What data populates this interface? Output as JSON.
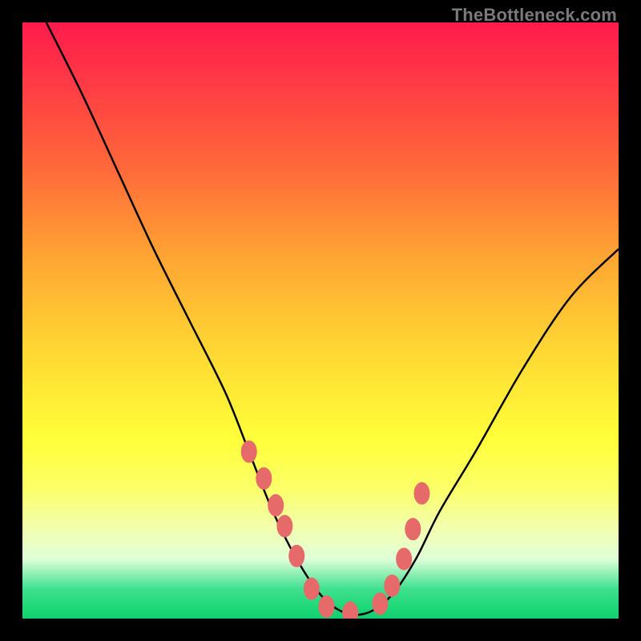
{
  "watermark": "TheBottleneck.com",
  "chart_data": {
    "type": "line",
    "title": "",
    "xlabel": "",
    "ylabel": "",
    "xlim": [
      0,
      100
    ],
    "ylim": [
      0,
      100
    ],
    "series": [
      {
        "name": "bottleneck-curve",
        "x": [
          4,
          10,
          16,
          22,
          28,
          34,
          38,
          42,
          46,
          50,
          54,
          58,
          62,
          66,
          70,
          76,
          84,
          92,
          100
        ],
        "values": [
          100,
          88,
          75,
          62,
          50,
          38,
          28,
          18,
          10,
          4,
          1,
          1,
          4,
          10,
          18,
          28,
          42,
          54,
          62
        ]
      }
    ],
    "markers": {
      "name": "highlighted-points",
      "x": [
        38,
        40.5,
        42.5,
        44,
        46,
        48.5,
        51,
        55,
        60,
        62,
        64,
        65.5,
        67
      ],
      "values": [
        28,
        23.5,
        19,
        15.5,
        10.5,
        5,
        2,
        1,
        2.5,
        5.5,
        10,
        15,
        21
      ]
    }
  }
}
